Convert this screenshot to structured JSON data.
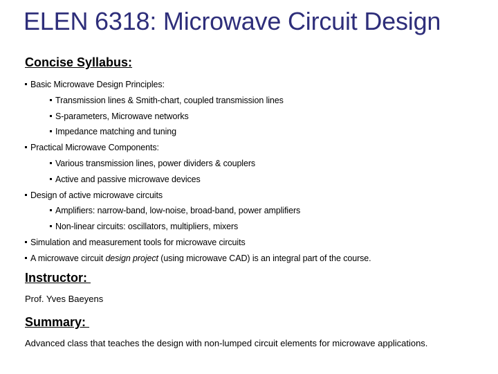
{
  "title": "ELEN 6318: Microwave Circuit Design",
  "syllabus": {
    "heading": "Concise Syllabus:",
    "items": [
      {
        "level": 1,
        "text": "Basic Microwave Design Principles:"
      },
      {
        "level": 2,
        "text": "Transmission lines & Smith-chart, coupled transmission lines"
      },
      {
        "level": 2,
        "text": "S-parameters, Microwave networks"
      },
      {
        "level": 2,
        "text": "Impedance matching and tuning"
      },
      {
        "level": 1,
        "text": "Practical Microwave Components:"
      },
      {
        "level": 2,
        "text": "Various transmission lines, power dividers & couplers"
      },
      {
        "level": 2,
        "text": "Active and passive microwave devices"
      },
      {
        "level": 1,
        "text": "Design of active microwave circuits"
      },
      {
        "level": 2,
        "text": "Amplifiers: narrow-band, low-noise, broad-band, power amplifiers"
      },
      {
        "level": 2,
        "text": "Non-linear circuits: oscillators, multipliers, mixers"
      },
      {
        "level": 1,
        "text": "Simulation and measurement tools for microwave circuits"
      }
    ],
    "project_item": {
      "prefix": "A microwave circuit ",
      "emphasis": "design project",
      "suffix": " (using microwave CAD) is an integral part of the course."
    }
  },
  "instructor": {
    "heading": "Instructor: ",
    "name": "Prof. Yves Baeyens"
  },
  "summary": {
    "heading": "Summary: ",
    "text": "Advanced class that teaches the design with non-lumped circuit elements for microwave applications."
  },
  "colors": {
    "title": "#2e2e7a",
    "text": "#000000",
    "background": "#ffffff"
  }
}
